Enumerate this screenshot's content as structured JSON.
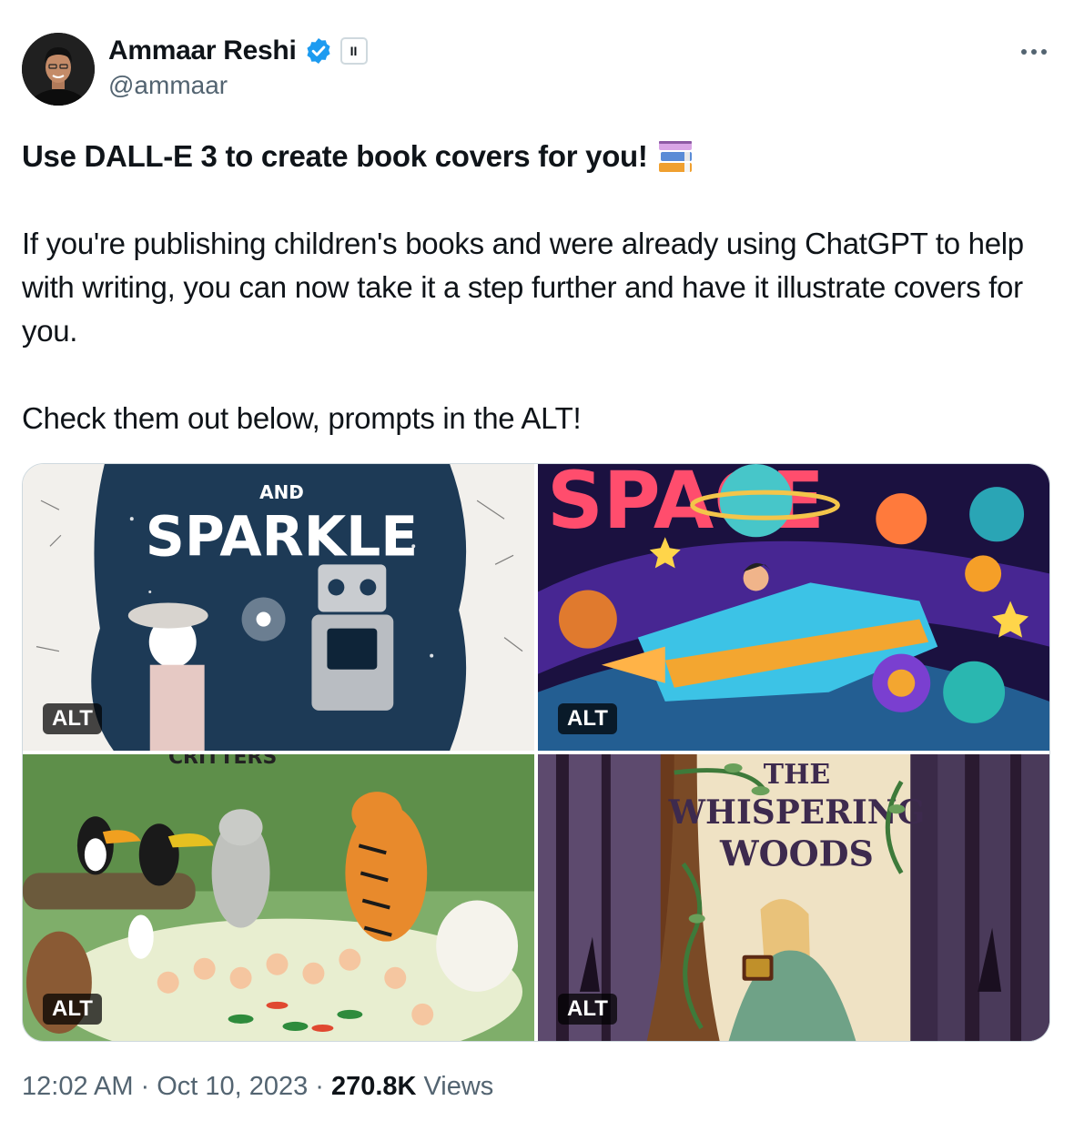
{
  "author": {
    "display_name": "Ammaar Reshi",
    "handle": "@ammaar",
    "affiliation_badge": "II"
  },
  "tweet": {
    "headline": "Use DALL-E 3 to create book covers for you!",
    "paragraph_1": "If you're publishing children's books and were already using ChatGPT to help with writing, you can now take it a step further and have it illustrate covers for you.",
    "paragraph_2": "Check them out below, prompts in the ALT!"
  },
  "media": [
    {
      "alt_label": "ALT",
      "cover_text": [
        "AND",
        "SPARKLE"
      ]
    },
    {
      "alt_label": "ALT",
      "cover_text": [
        "SPACE"
      ]
    },
    {
      "alt_label": "ALT",
      "cover_text": [
        "CRITTERS"
      ]
    },
    {
      "alt_label": "ALT",
      "cover_text": [
        "THE",
        "WHISPERING",
        "WOODS"
      ]
    }
  ],
  "meta": {
    "time": "12:02 AM",
    "sep1": "·",
    "date": "Oct 10, 2023",
    "sep2": "·",
    "views_count": "270.8K",
    "views_label": "Views"
  },
  "colors": {
    "verified_blue": "#1d9bf0",
    "text_primary": "#0f1419",
    "text_secondary": "#536471"
  }
}
